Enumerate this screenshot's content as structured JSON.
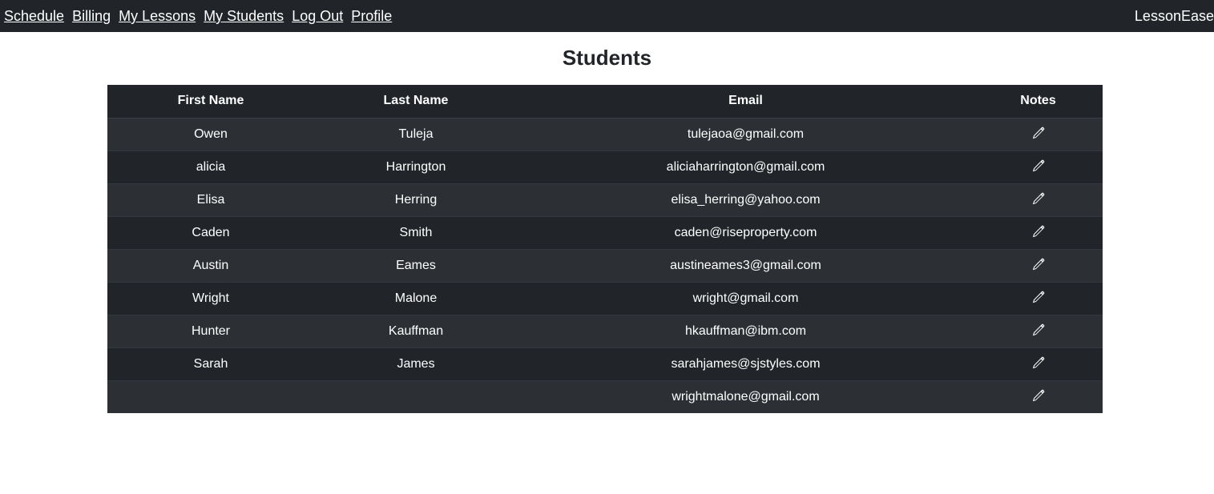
{
  "nav": {
    "links": [
      "Schedule",
      "Billing",
      "My Lessons",
      "My Students",
      "Log Out",
      "Profile"
    ],
    "brand": "LessonEase"
  },
  "page": {
    "title": "Students"
  },
  "table": {
    "headers": {
      "first_name": "First Name",
      "last_name": "Last Name",
      "email": "Email",
      "notes": "Notes"
    },
    "rows": [
      {
        "first": "Owen",
        "last": "Tuleja",
        "email": "tulejaoa@gmail.com",
        "notes_icon": "pencil-icon"
      },
      {
        "first": "alicia",
        "last": "Harrington",
        "email": "aliciaharrington@gmail.com",
        "notes_icon": "pencil-icon"
      },
      {
        "first": "Elisa",
        "last": "Herring",
        "email": "elisa_herring@yahoo.com",
        "notes_icon": "pencil-icon"
      },
      {
        "first": "Caden",
        "last": "Smith",
        "email": "caden@riseproperty.com",
        "notes_icon": "pencil-icon"
      },
      {
        "first": "Austin",
        "last": "Eames",
        "email": "austineames3@gmail.com",
        "notes_icon": "pencil-icon"
      },
      {
        "first": "Wright",
        "last": "Malone",
        "email": "wright@gmail.com",
        "notes_icon": "pencil-icon"
      },
      {
        "first": "Hunter",
        "last": "Kauffman",
        "email": "hkauffman@ibm.com",
        "notes_icon": "pencil-icon"
      },
      {
        "first": "Sarah",
        "last": "James",
        "email": "sarahjames@sjstyles.com",
        "notes_icon": "pencil-icon"
      },
      {
        "first": "",
        "last": "",
        "email": "wrightmalone@gmail.com",
        "notes_icon": "pencil-icon"
      }
    ]
  },
  "colors": {
    "navbar_bg": "#212529",
    "row_dark": "#212529",
    "row_light": "#2c3034",
    "text_light": "#ffffff",
    "title_text": "#212529"
  }
}
